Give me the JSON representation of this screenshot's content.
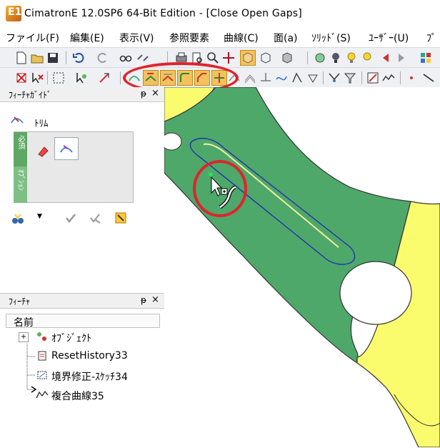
{
  "window": {
    "title": "CimatronE 12.0SP6  64-Bit Edition - [Close Open Gaps]",
    "app_icon_text": "E12"
  },
  "menu": [
    "ファイル(F)",
    "編集(E)",
    "表示(V)",
    "参照要素",
    "曲線(C)",
    "面(a)",
    "ｿﾘｯﾄﾞ(S)",
    "ﾕｰｻﾞｰ(U)",
    "ﾌﾟ"
  ],
  "feature_guide": {
    "title": "ﾌｨｰﾁｬｶﾞｲﾄﾞ",
    "command": "ﾄﾘﾑ",
    "required_label": "必須",
    "option_label": "ｵﾌﾟｼｮﾝ"
  },
  "feature_tree": {
    "title": "ﾌｨｰﾁｬ",
    "column_header": "名前",
    "items": [
      {
        "label": "ｵﾌﾞｼﾞｪｸﾄ",
        "expander": "+"
      },
      {
        "label": "ResetHistory33"
      },
      {
        "label": "境界修正-ｽｹｯﾁ34"
      },
      {
        "label": "複合曲線35"
      }
    ]
  },
  "panel_controls": {
    "pin": "ᵽ",
    "close": "×"
  },
  "colors": {
    "accent_green": "#4ea86a",
    "face_yellow": "#fbfb6e",
    "highlight_red": "#e0232a",
    "curve_blue": "#2233aa"
  }
}
